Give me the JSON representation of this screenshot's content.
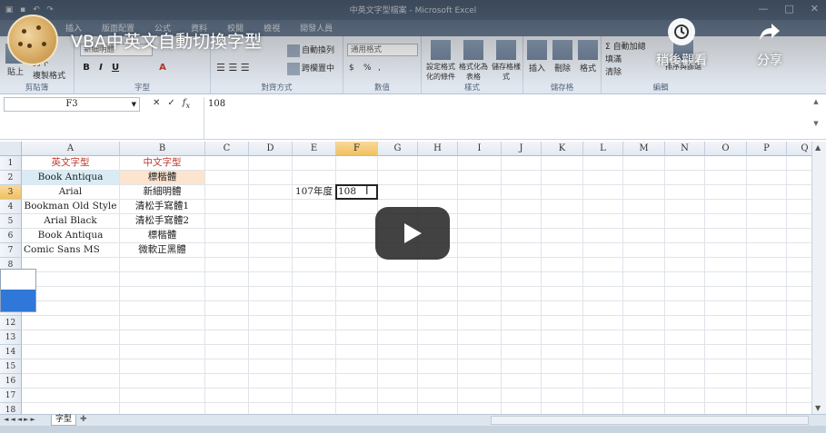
{
  "window": {
    "title": "中英文字型檔案 - Microsoft Excel",
    "controls": [
      "—",
      "□",
      "✕"
    ]
  },
  "ribbon": {
    "tabs": [
      "插入",
      "版面配置",
      "公式",
      "資料",
      "校閱",
      "檢視",
      "開發人員"
    ],
    "clipboard": {
      "paste": "貼上",
      "cut": "剪下",
      "copy_format": "複製格式",
      "label": "剪貼簿"
    },
    "font": {
      "name": "新細明體",
      "bold": "B",
      "italic": "I",
      "underline": "U",
      "label": "字型"
    },
    "alignment": {
      "wrap": "自動換列",
      "merge": "跨欄置中",
      "label": "對齊方式"
    },
    "number": {
      "format": "通用格式",
      "currency": "$",
      "percent": "%",
      "comma": ",",
      "label": "數值"
    },
    "styles": {
      "conditional": "設定格式化的條件",
      "table": "格式化為表格",
      "cell": "儲存格樣式",
      "label": "樣式"
    },
    "cells": {
      "insert": "插入",
      "delete": "刪除",
      "format": "格式",
      "label": "儲存格"
    },
    "editing": {
      "autosum": "自動加總",
      "fill": "填滿",
      "clear": "清除",
      "sort": "排序與篩選",
      "find": "尋找與選取",
      "label": "編輯"
    }
  },
  "formula_bar": {
    "name_box": "F3",
    "value": "108"
  },
  "columns": [
    "A",
    "B",
    "C",
    "D",
    "E",
    "F",
    "G",
    "H",
    "I",
    "J",
    "K",
    "L",
    "M",
    "N",
    "O",
    "P",
    "Q"
  ],
  "rows": [
    "1",
    "2",
    "3",
    "4",
    "5",
    "6",
    "7",
    "8",
    "9",
    "10",
    "11",
    "12",
    "13",
    "14",
    "15",
    "16",
    "17",
    "18"
  ],
  "cells": {
    "A1": "英文字型",
    "B1": "中文字型",
    "A2": "Book Antiqua",
    "B2": "標楷體",
    "A3": "Arial",
    "B3": "新細明體",
    "A4": "Bookman Old Style",
    "B4": "清松手寫體1",
    "A5": "Arial Black",
    "B5": "清松手寫體2",
    "A6": "Book Antiqua",
    "B6": "標楷體",
    "A7": "Comic Sans MS",
    "B7": "微軟正黑體",
    "E3": "107年度",
    "F3": "108"
  },
  "sheet_tab": "字型",
  "video_overlay": {
    "title": "VBA中英文自動切換字型",
    "watch_later": "稍後觀看",
    "share": "分享"
  },
  "colors": {
    "header_red": "#c0392b",
    "row2_a_fill": "#d9ecf5",
    "row2_b_fill": "#fce4cf",
    "selection_header": "#f1c15f",
    "overlay_blue": "#2f77d8"
  }
}
